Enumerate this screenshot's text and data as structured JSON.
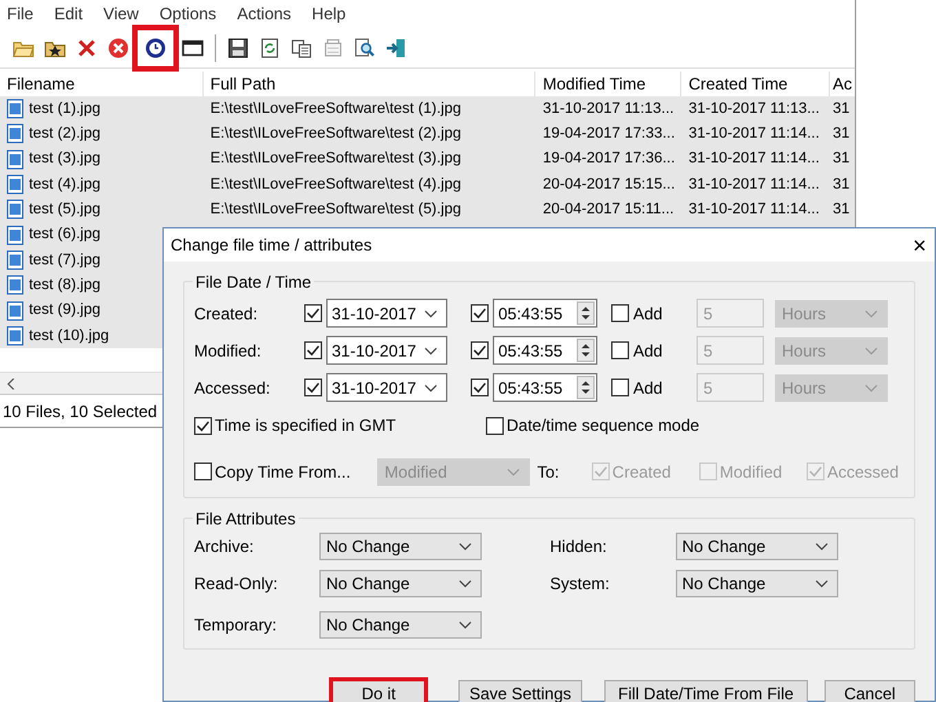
{
  "menu": [
    "File",
    "Edit",
    "View",
    "Options",
    "Actions",
    "Help"
  ],
  "toolbar": [
    {
      "kind": "open",
      "highlighted": false
    },
    {
      "kind": "star-folder",
      "highlighted": false
    },
    {
      "kind": "cross",
      "highlighted": false
    },
    {
      "kind": "stop",
      "highlighted": false
    },
    {
      "kind": "clock",
      "highlighted": true
    },
    {
      "kind": "window",
      "highlighted": false
    },
    {
      "kind": "separator"
    },
    {
      "kind": "save",
      "highlighted": false
    },
    {
      "kind": "refresh",
      "highlighted": false
    },
    {
      "kind": "copy",
      "highlighted": false
    },
    {
      "kind": "properties",
      "highlighted": false
    },
    {
      "kind": "find",
      "highlighted": false
    },
    {
      "kind": "exit",
      "highlighted": false
    }
  ],
  "table": {
    "columns": [
      "Filename",
      "Full Path",
      "Modified Time",
      "Created Time",
      "Ac"
    ],
    "rows": [
      {
        "selected": true,
        "cells": [
          "test (1).jpg",
          "E:\\test\\ILoveFreeSoftware\\test (1).jpg",
          "31-10-2017 11:13...",
          "31-10-2017 11:13...",
          "31"
        ]
      },
      {
        "selected": true,
        "cells": [
          "test (2).jpg",
          "E:\\test\\ILoveFreeSoftware\\test (2).jpg",
          "19-04-2017 17:33...",
          "31-10-2017 11:14...",
          "31"
        ]
      },
      {
        "selected": true,
        "cells": [
          "test (3).jpg",
          "E:\\test\\ILoveFreeSoftware\\test (3).jpg",
          "19-04-2017 17:36...",
          "31-10-2017 11:14...",
          "31"
        ]
      },
      {
        "selected": true,
        "cells": [
          "test (4).jpg",
          "E:\\test\\ILoveFreeSoftware\\test (4).jpg",
          "20-04-2017 15:15...",
          "31-10-2017 11:14...",
          "31"
        ]
      },
      {
        "selected": true,
        "cells": [
          "test (5).jpg",
          "E:\\test\\ILoveFreeSoftware\\test (5).jpg",
          "20-04-2017 15:11...",
          "31-10-2017 11:14...",
          "31"
        ]
      },
      {
        "selected": true,
        "cells": [
          "test (6).jpg"
        ]
      },
      {
        "selected": true,
        "cells": [
          "test (7).jpg"
        ]
      },
      {
        "selected": true,
        "cells": [
          "test (8).jpg"
        ]
      },
      {
        "selected": true,
        "cells": [
          "test (9).jpg"
        ]
      },
      {
        "selected": true,
        "cells": [
          "test (10).jpg"
        ]
      }
    ]
  },
  "status_bar": "10 Files, 10 Selected",
  "dialog": {
    "title": "Change file time / attributes",
    "close": "×",
    "date_time_group": {
      "title": "File Date / Time",
      "rows": [
        {
          "label": "Created:",
          "date_checked": true,
          "date": "31-10-2017",
          "time_checked": true,
          "time": "05:43:55",
          "add_label": "Add",
          "add_checked": false,
          "amount": "5",
          "unit": "Hours"
        },
        {
          "label": "Modified:",
          "date_checked": true,
          "date": "31-10-2017",
          "time_checked": true,
          "time": "05:43:55",
          "add_label": "Add",
          "add_checked": false,
          "amount": "5",
          "unit": "Hours"
        },
        {
          "label": "Accessed:",
          "date_checked": true,
          "date": "31-10-2017",
          "time_checked": true,
          "time": "05:43:55",
          "add_label": "Add",
          "add_checked": false,
          "amount": "5",
          "unit": "Hours"
        }
      ],
      "gmt": {
        "label": "Time is specified in GMT",
        "checked": true
      },
      "sequence_mode": {
        "label": "Date/time sequence mode",
        "checked": false
      },
      "copy_time": {
        "label": "Copy Time From...",
        "checked": false,
        "source": "Modified",
        "to_label": "To:",
        "targets": [
          {
            "label": "Created",
            "checked": true
          },
          {
            "label": "Modified",
            "checked": false
          },
          {
            "label": "Accessed",
            "checked": true
          }
        ]
      }
    },
    "attributes_group": {
      "title": "File Attributes",
      "items": [
        {
          "label": "Archive:",
          "value": "No Change"
        },
        {
          "label": "Hidden:",
          "value": "No Change"
        },
        {
          "label": "Read-Only:",
          "value": "No Change"
        },
        {
          "label": "System:",
          "value": "No Change"
        },
        {
          "label": "Temporary:",
          "value": "No Change"
        }
      ]
    },
    "buttons": [
      {
        "label": "Do it",
        "highlighted": true
      },
      {
        "label": "Save Settings",
        "highlighted": false
      },
      {
        "label": "Fill Date/Time From File",
        "highlighted": false
      },
      {
        "label": "Cancel",
        "highlighted": false
      }
    ]
  }
}
